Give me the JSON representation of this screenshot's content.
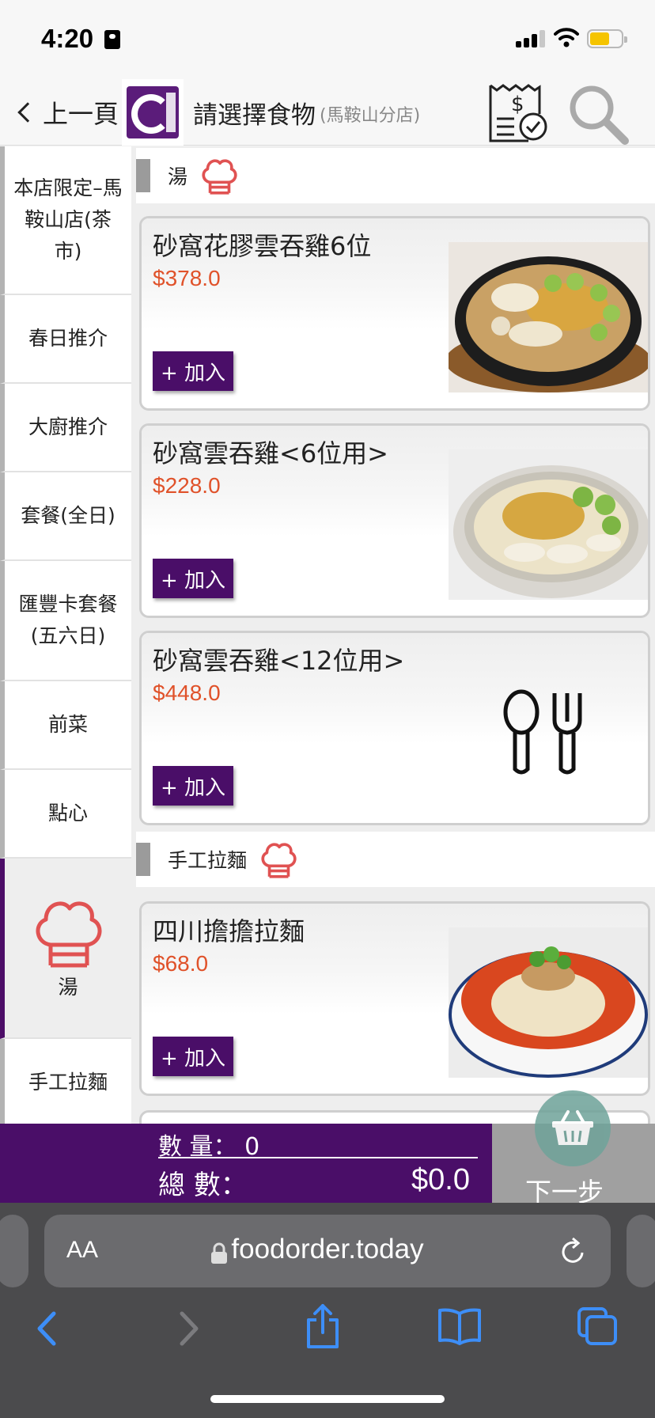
{
  "status": {
    "time": "4:20"
  },
  "header": {
    "back_label": "上一頁",
    "title": "請選擇食物",
    "branch": "(馬鞍山分店)"
  },
  "sidebar": {
    "items": [
      {
        "label": "本店限定–馬鞍山店(茶市)",
        "active": false
      },
      {
        "label": "春日推介",
        "active": false
      },
      {
        "label": "大廚推介",
        "active": false
      },
      {
        "label": "套餐(全日)",
        "active": false
      },
      {
        "label": "匯豐卡套餐(五六日)",
        "active": false
      },
      {
        "label": "前菜",
        "active": false
      },
      {
        "label": "點心",
        "active": false
      },
      {
        "label": "湯",
        "active": true
      },
      {
        "label": "手工拉麵",
        "active": false
      }
    ]
  },
  "categories": [
    {
      "name": "湯",
      "items": [
        {
          "name": "砂窩花膠雲吞雞6位",
          "price": "$378.0",
          "add_label": "+ 加入",
          "image": "claypot-fish-maw-chicken"
        },
        {
          "name": "砂窩雲吞雞<6位用>",
          "price": "$228.0",
          "add_label": "+ 加入",
          "image": "claypot-wonton-chicken"
        },
        {
          "name": "砂窩雲吞雞<12位用>",
          "price": "$448.0",
          "add_label": "+ 加入",
          "image": "spoon-fork-placeholder-icon"
        }
      ]
    },
    {
      "name": "手工拉麵",
      "items": [
        {
          "name": "四川擔擔拉麵",
          "price": "$68.0",
          "add_label": "+ 加入",
          "image": "dandan-noodles"
        }
      ]
    }
  ],
  "order": {
    "qty_label": "數 量：",
    "qty_value": "0",
    "total_label": "總 數：",
    "total_value": "$0.0",
    "next_label": "下一步"
  },
  "browser": {
    "text_size_label": "AA",
    "url": "foodorder.today"
  },
  "colors": {
    "brand_purple": "#4a0e68",
    "price_orange": "#e0522a",
    "chef_icon_red": "#e05252"
  }
}
